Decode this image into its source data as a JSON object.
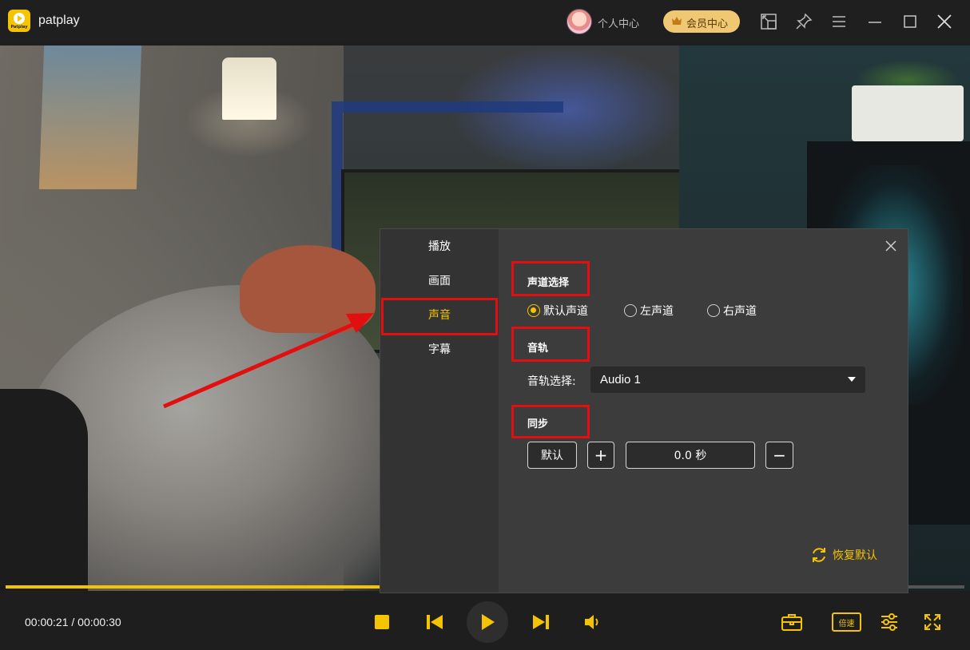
{
  "app": {
    "name": "patplay",
    "logo_text": "Patplay"
  },
  "titlebar": {
    "profile_label": "个人中心",
    "vip_label": "会员中心",
    "icons": [
      "picture-in-picture-icon",
      "pin-icon",
      "menu-icon",
      "minimize-icon",
      "maximize-icon",
      "close-icon"
    ]
  },
  "player": {
    "current_time": "00:00:21",
    "total_time": "00:00:30",
    "time_display": "00:00:21 / 00:00:30",
    "progress": 0.7,
    "speed_label": "倍速",
    "accent_color": "#f5c400"
  },
  "settings": {
    "nav": [
      {
        "label": "播放"
      },
      {
        "label": "画面"
      },
      {
        "label": "声音",
        "active": true
      },
      {
        "label": "字幕"
      }
    ],
    "channel": {
      "title": "声道选择",
      "options": [
        {
          "label": "默认声道",
          "checked": true
        },
        {
          "label": "左声道",
          "checked": false
        },
        {
          "label": "右声道",
          "checked": false
        }
      ]
    },
    "track": {
      "title": "音轨",
      "label": "音轨选择:",
      "value": "Audio 1"
    },
    "sync": {
      "title": "同步",
      "default_label": "默认",
      "plus_label": "+",
      "value": "0.0 秒",
      "minus_label": "−"
    },
    "restore_label": "恢复默认"
  },
  "annotation_color": "#e10f0f"
}
